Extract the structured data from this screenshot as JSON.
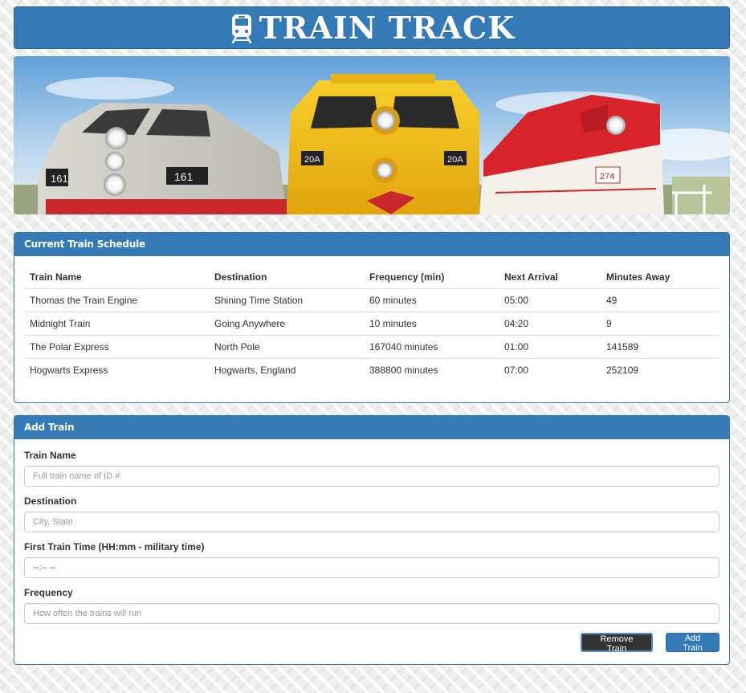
{
  "header": {
    "title": "TRAIN TRACK",
    "icon": "train-front-icon",
    "color": "#337ab7"
  },
  "banner": {
    "description_icon": "trains-banner",
    "train_numbers": [
      "161",
      "20A",
      "20A",
      "274"
    ]
  },
  "schedule": {
    "heading": "Current Train Schedule",
    "columns": [
      "Train Name",
      "Destination",
      "Frequency (min)",
      "Next Arrival",
      "Minutes Away"
    ],
    "rows": [
      [
        "Thomas the Train Engine",
        "Shining Time Station",
        "60 minutes",
        "05:00",
        "49"
      ],
      [
        "Midnight Train",
        "Going Anywhere",
        "10 minutes",
        "04:20",
        "9"
      ],
      [
        "The Polar Express",
        "North Pole",
        "167040 minutes",
        "01:00",
        "141589"
      ],
      [
        "Hogwarts Express",
        "Hogwarts, England",
        "388800 minutes",
        "07:00",
        "252109"
      ]
    ]
  },
  "add_train": {
    "heading": "Add Train",
    "fields": {
      "name": {
        "label": "Train Name",
        "placeholder": "Full train name of ID #",
        "value": ""
      },
      "destination": {
        "label": "Destination",
        "placeholder": "City, State",
        "value": ""
      },
      "first_time": {
        "label": "First Train Time (HH:mm - military time)",
        "placeholder": "",
        "value": "--:-- --"
      },
      "frequency": {
        "label": "Frequency",
        "placeholder": "How often the trains will run",
        "value": ""
      }
    },
    "buttons": {
      "remove": "Remove Train",
      "add": "Add Train"
    }
  }
}
